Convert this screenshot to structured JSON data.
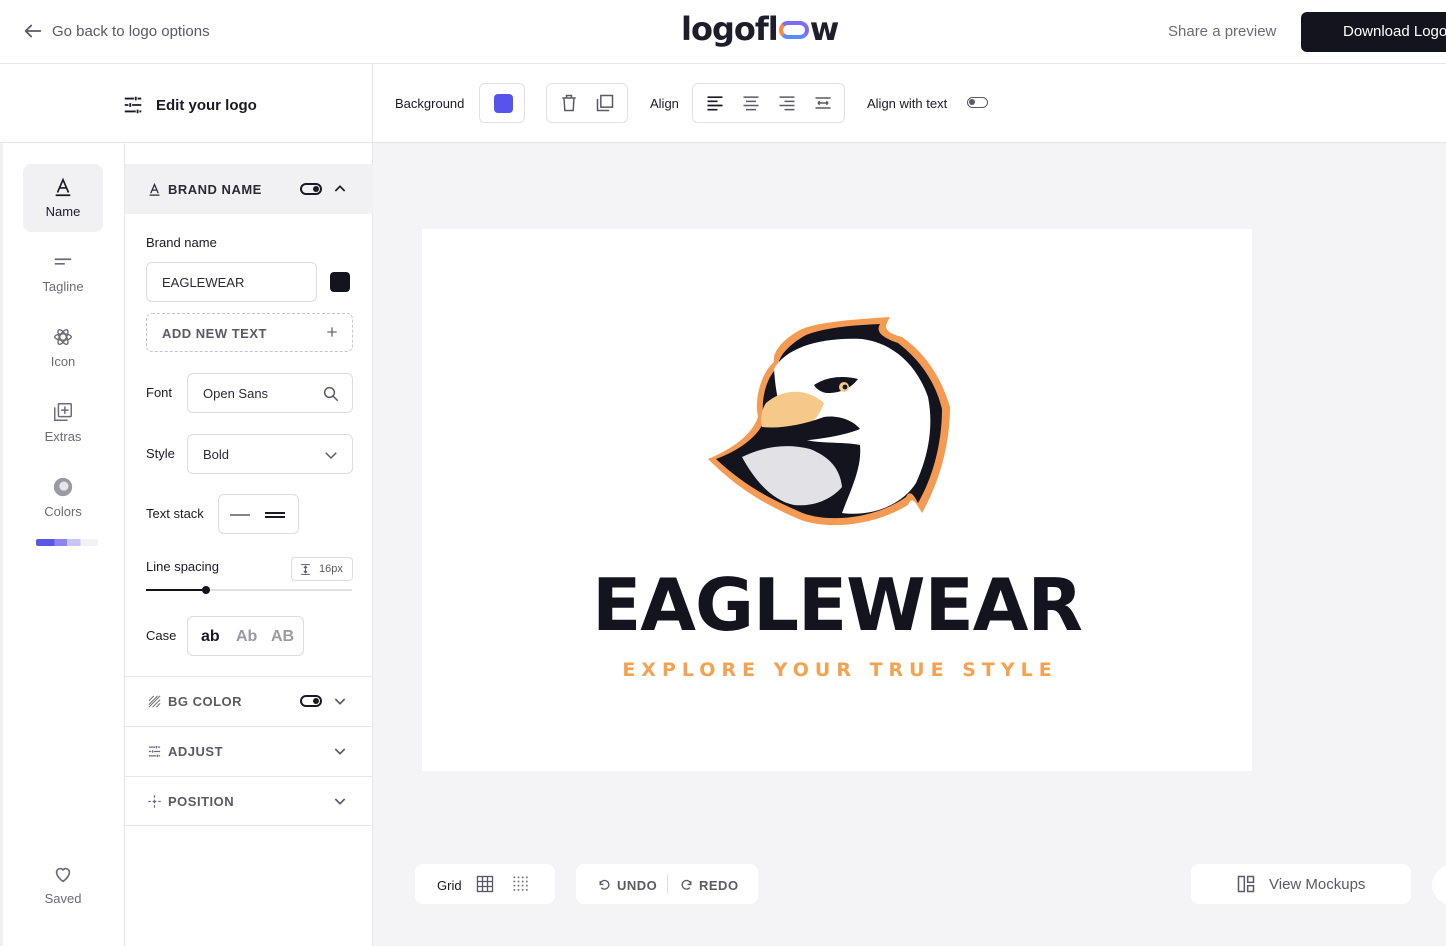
{
  "topbar": {
    "back_label": "Go back to logo options",
    "brand": "logoflow",
    "share_label": "Share a preview",
    "download_label": "Download Logo"
  },
  "edit": {
    "title": "Edit your logo"
  },
  "rail": {
    "items": [
      {
        "label": "Name",
        "icon": "text-a-icon",
        "active": true
      },
      {
        "label": "Tagline",
        "icon": "tagline-lines-icon"
      },
      {
        "label": "Icon",
        "icon": "atom-icon"
      },
      {
        "label": "Extras",
        "icon": "add-layer-icon"
      },
      {
        "label": "Colors",
        "icon": "color-circle-icon"
      }
    ],
    "saved_label": "Saved",
    "palette": [
      "#5b56e8",
      "#8c87f0",
      "#c8c6f6",
      "#f2f2f6"
    ]
  },
  "brand_section": {
    "title": "BRAND NAME",
    "enabled": true,
    "brand_name_label": "Brand name",
    "brand_name_value": "EAGLEWEAR",
    "text_color": "#14141f",
    "add_text_label": "ADD NEW TEXT",
    "font_label": "Font",
    "font_value": "Open Sans",
    "style_label": "Style",
    "style_value": "Bold",
    "text_stack_label": "Text stack",
    "line_spacing_label": "Line spacing",
    "line_spacing_value": "16px",
    "line_spacing_level": 0.29,
    "case_label": "Case",
    "case_options": [
      "ab",
      "Ab",
      "AB"
    ],
    "case_selected": "ab"
  },
  "collapsed_sections": [
    {
      "title": "BG COLOR",
      "has_toggle": true
    },
    {
      "title": "ADJUST"
    },
    {
      "title": "POSITION"
    }
  ],
  "toolbar": {
    "background_label": "Background",
    "background_color": "#5654ea",
    "align_label": "Align",
    "align_with_text_label": "Align with text",
    "align_with_text_on": false
  },
  "logo": {
    "name": "EAGLEWEAR",
    "tagline": "EXPLORE YOUR TRUE STYLE",
    "name_color": "#14141f",
    "tagline_color": "#f4a24f"
  },
  "bottom": {
    "grid_label": "Grid",
    "undo_label": "UNDO",
    "redo_label": "REDO",
    "mockups_label": "View Mockups"
  }
}
